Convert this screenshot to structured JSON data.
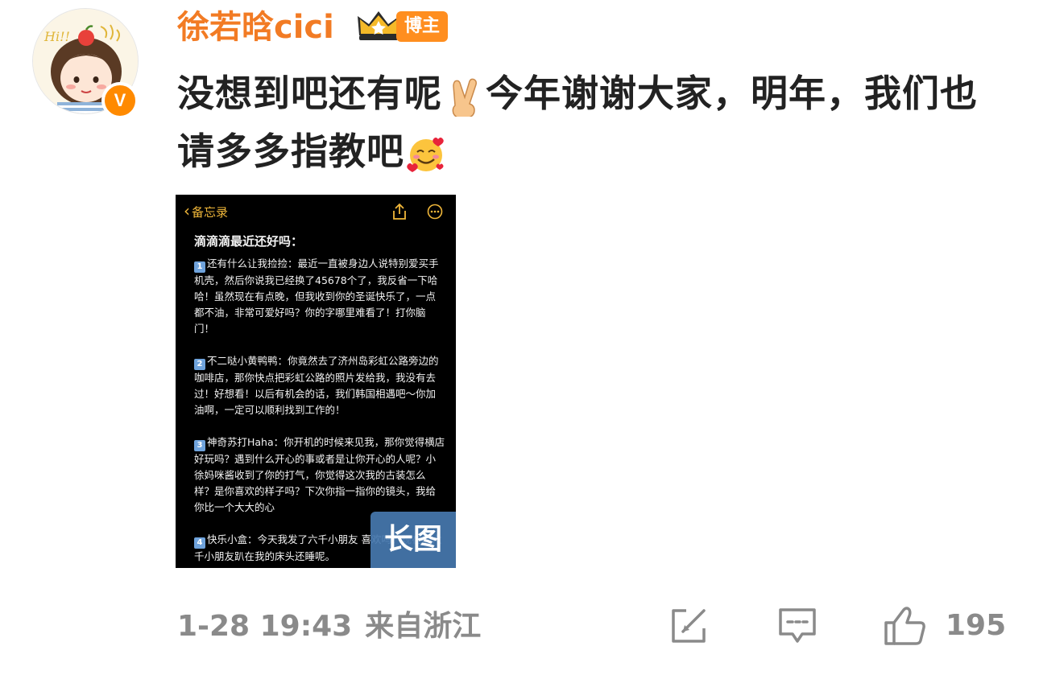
{
  "user": {
    "name": "徐若晗cici",
    "badge_label": "博主",
    "verified_mark": "V",
    "avatar_text": "Hi!!"
  },
  "post": {
    "text_before_emoji": "没想到吧还有呢",
    "text_middle": "今年谢谢大家，明年，我们也请多多指教吧",
    "emoji1": "victory-hand-emoji",
    "emoji2": "smiling-face-with-hearts-emoji"
  },
  "attachment": {
    "back_label": "备忘录",
    "title": "滴滴滴最近还好吗：",
    "paragraphs": [
      {
        "num": "1",
        "text": "还有什么让我捡捡：最近一直被身边人说特别爱买手机壳，然后你说我已经换了45678个了，我反省一下哈哈！虽然现在有点晚，但我收到你的圣诞快乐了，一点都不油，非常可爱好吗？你的字哪里难看了！打你脑门！"
      },
      {
        "num": "2",
        "text": "不二哒小黄鸭鸭：你竟然去了济州岛彩虹公路旁边的咖啡店，那你快点把彩虹公路的照片发给我，我没有去过！好想看！以后有机会的话，我们韩国相遇吧～你加油啊，一定可以顺利找到工作的！"
      },
      {
        "num": "3",
        "text": "神奇苏打Haha：你开机的时候来见我，那你觉得横店好玩吗？遇到什么开心的事或者是让你开心的人呢？小徐妈咪酱收到了你的打气，你觉得这次我的古装怎么样？是你喜欢的样子吗？下次你指一指你的镜头，我给你比一个大大的心"
      },
      {
        "num": "4",
        "text": "快乐小盒：今天我发了六千小朋友 喜欢吗？现在的六千小朋友趴在我的床头还睡呢。"
      }
    ],
    "long_image_label": "长图"
  },
  "footer": {
    "date": "1-28 19:43",
    "source": "来自浙江",
    "like_count": "195"
  },
  "colors": {
    "username": "#f27b24",
    "badge": "#ff8e1f",
    "text": "#222222",
    "meta": "#8a8a8a",
    "note_accent": "#f0b73a"
  }
}
